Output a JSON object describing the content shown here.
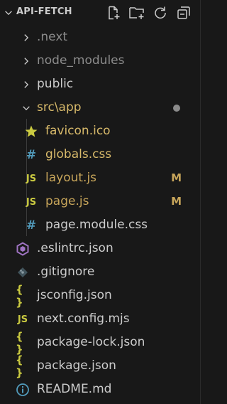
{
  "explorer": {
    "title": "API-FETCH",
    "actions": [
      {
        "name": "new-file",
        "icon": "new-file-icon"
      },
      {
        "name": "new-folder",
        "icon": "new-folder-icon"
      },
      {
        "name": "refresh",
        "icon": "refresh-icon"
      },
      {
        "name": "collapse-all",
        "icon": "collapse-all-icon"
      }
    ],
    "tree": [
      {
        "label": ".next",
        "kind": "folder",
        "expanded": false,
        "color": "#8c8c8c"
      },
      {
        "label": "node_modules",
        "kind": "folder",
        "expanded": false,
        "color": "#8c8c8c"
      },
      {
        "label": "public",
        "kind": "folder",
        "expanded": false,
        "color": "#cccccc"
      },
      {
        "label": "src\\app",
        "kind": "folder",
        "expanded": true,
        "color": "#d7b96a",
        "modified_dot": true
      },
      {
        "label": "favicon.ico",
        "kind": "file",
        "icon": "star-icon",
        "color": "#d7b96a"
      },
      {
        "label": "globals.css",
        "kind": "file",
        "icon": "hash-icon",
        "color": "#d7b96a"
      },
      {
        "label": "layout.js",
        "kind": "file",
        "icon": "js-icon",
        "color": "#c7a55a",
        "badge": "M"
      },
      {
        "label": "page.js",
        "kind": "file",
        "icon": "js-icon",
        "color": "#c7a55a",
        "badge": "M"
      },
      {
        "label": "page.module.css",
        "kind": "file",
        "icon": "hash-icon",
        "color": "#cccccc"
      },
      {
        "label": ".eslintrc.json",
        "kind": "file",
        "icon": "eslint-icon",
        "color": "#cccccc"
      },
      {
        "label": ".gitignore",
        "kind": "file",
        "icon": "git-icon",
        "color": "#cccccc"
      },
      {
        "label": "jsconfig.json",
        "kind": "file",
        "icon": "braces-icon",
        "color": "#cccccc"
      },
      {
        "label": "next.config.mjs",
        "kind": "file",
        "icon": "js-icon",
        "color": "#cccccc"
      },
      {
        "label": "package-lock.json",
        "kind": "file",
        "icon": "braces-icon",
        "color": "#cccccc"
      },
      {
        "label": "package.json",
        "kind": "file",
        "icon": "braces-icon",
        "color": "#cccccc"
      },
      {
        "label": "README.md",
        "kind": "file",
        "icon": "info-icon",
        "color": "#cccccc"
      }
    ],
    "colors": {
      "background": "#181818",
      "js_yellow": "#cbcb41",
      "css_blue": "#519aba",
      "json_yellow": "#cbcb41",
      "eslint_purple": "#a074c4",
      "info_blue": "#519aba",
      "modified": "#c7a55a"
    }
  }
}
